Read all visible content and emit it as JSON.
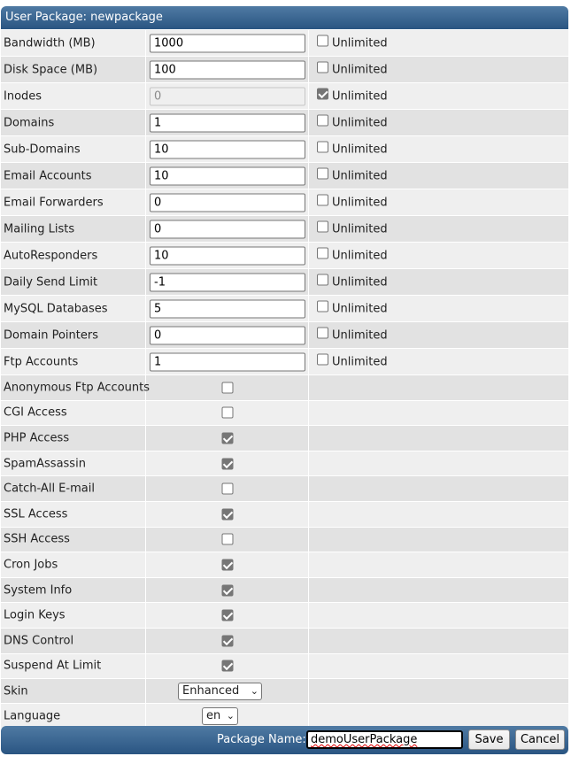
{
  "title": "User Package: newpackage",
  "unlimited_label": "Unlimited",
  "limits": [
    {
      "label": "Bandwidth (MB)",
      "value": "1000",
      "unlimited": false,
      "disabled": false
    },
    {
      "label": "Disk Space (MB)",
      "value": "100",
      "unlimited": false,
      "disabled": false
    },
    {
      "label": "Inodes",
      "value": "0",
      "unlimited": true,
      "disabled": true
    },
    {
      "label": "Domains",
      "value": "1",
      "unlimited": false,
      "disabled": false
    },
    {
      "label": "Sub-Domains",
      "value": "10",
      "unlimited": false,
      "disabled": false
    },
    {
      "label": "Email Accounts",
      "value": "10",
      "unlimited": false,
      "disabled": false
    },
    {
      "label": "Email Forwarders",
      "value": "0",
      "unlimited": false,
      "disabled": false
    },
    {
      "label": "Mailing Lists",
      "value": "0",
      "unlimited": false,
      "disabled": false
    },
    {
      "label": "AutoResponders",
      "value": "10",
      "unlimited": false,
      "disabled": false
    },
    {
      "label": "Daily Send Limit",
      "value": "-1",
      "unlimited": false,
      "disabled": false
    },
    {
      "label": "MySQL Databases",
      "value": "5",
      "unlimited": false,
      "disabled": false
    },
    {
      "label": "Domain Pointers",
      "value": "0",
      "unlimited": false,
      "disabled": false
    },
    {
      "label": "Ftp Accounts",
      "value": "1",
      "unlimited": false,
      "disabled": false
    }
  ],
  "features": [
    {
      "label": "Anonymous Ftp Accounts",
      "checked": false
    },
    {
      "label": "CGI Access",
      "checked": false
    },
    {
      "label": "PHP Access",
      "checked": true
    },
    {
      "label": "SpamAssassin",
      "checked": true
    },
    {
      "label": "Catch-All E-mail",
      "checked": false
    },
    {
      "label": "SSL Access",
      "checked": true
    },
    {
      "label": "SSH Access",
      "checked": false
    },
    {
      "label": "Cron Jobs",
      "checked": true
    },
    {
      "label": "System Info",
      "checked": true
    },
    {
      "label": "Login Keys",
      "checked": true
    },
    {
      "label": "DNS Control",
      "checked": true
    },
    {
      "label": "Suspend At Limit",
      "checked": true
    }
  ],
  "skin": {
    "label": "Skin",
    "value": "Enhanced"
  },
  "language": {
    "label": "Language",
    "value": "en"
  },
  "footer": {
    "package_name_label": "Package Name:",
    "package_name_value": "demoUserPackage",
    "save_label": "Save",
    "cancel_label": "Cancel"
  }
}
